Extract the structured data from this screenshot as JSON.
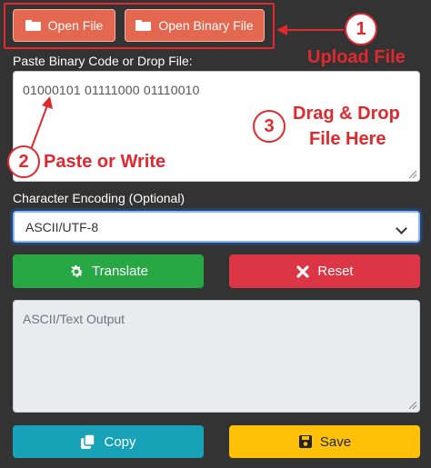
{
  "top_buttons": {
    "open_file": "Open File",
    "open_binary_file": "Open Binary File"
  },
  "input": {
    "label": "Paste Binary Code or Drop File:",
    "value": "01000101 01111000 01110010"
  },
  "encoding": {
    "label": "Character Encoding (Optional)",
    "selected": "ASCII/UTF-8"
  },
  "actions": {
    "translate": "Translate",
    "reset": "Reset"
  },
  "output": {
    "placeholder": "ASCII/Text Output"
  },
  "bottom_buttons": {
    "copy": "Copy",
    "save": "Save"
  },
  "annotations": {
    "step1_number": "1",
    "step1_text": "Upload File",
    "step2_number": "2",
    "step2_text": "Paste or Write",
    "step3_number": "3",
    "step3_line1": "Drag & Drop",
    "step3_line2": "File Here"
  },
  "colors": {
    "background": "#333333",
    "accent_orange": "#e4674f",
    "annotation_red": "#e0282e",
    "green": "#28a745",
    "red": "#dc3545",
    "teal": "#17a2b8",
    "yellow": "#ffc107"
  },
  "icons": [
    "folder-icon",
    "gear-icon",
    "close-icon",
    "copy-icon",
    "save-icon"
  ]
}
